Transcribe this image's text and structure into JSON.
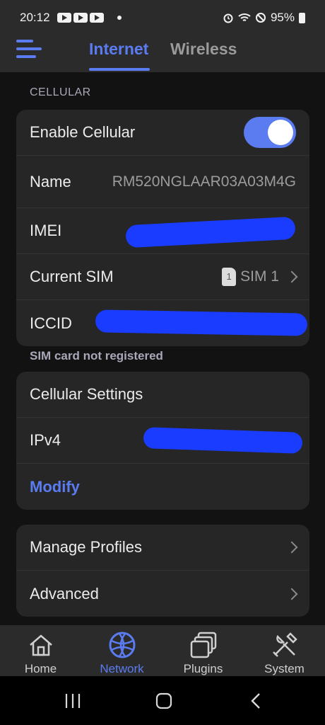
{
  "status_bar": {
    "time": "20:12",
    "battery": "95%"
  },
  "top_nav": {
    "tabs": [
      {
        "label": "Internet",
        "active": true
      },
      {
        "label": "Wireless",
        "active": false
      }
    ]
  },
  "cellular": {
    "header": "CELLULAR",
    "enable_label": "Enable Cellular",
    "enabled": true,
    "name_label": "Name",
    "name_value": "RM520NGLAAR03A03M4G",
    "imei_label": "IMEI",
    "sim_label": "Current SIM",
    "sim_badge": "1",
    "sim_value": "SIM 1",
    "iccid_label": "ICCID",
    "note": "SIM card not registered"
  },
  "cellular_settings": {
    "title": "Cellular Settings",
    "ipv4_label": "IPv4",
    "modify_label": "Modify"
  },
  "more": {
    "manage_profiles": "Manage Profiles",
    "advanced": "Advanced"
  },
  "bottom_nav": {
    "items": [
      {
        "label": "Home",
        "icon": "home-icon",
        "active": false
      },
      {
        "label": "Network",
        "icon": "globe-icon",
        "active": true
      },
      {
        "label": "Plugins",
        "icon": "plugins-icon",
        "active": false
      },
      {
        "label": "System",
        "icon": "tools-icon",
        "active": false
      }
    ]
  },
  "colors": {
    "accent": "#5b7cf0",
    "background": "#121212",
    "card": "#262626",
    "redaction": "#1a3cff"
  }
}
